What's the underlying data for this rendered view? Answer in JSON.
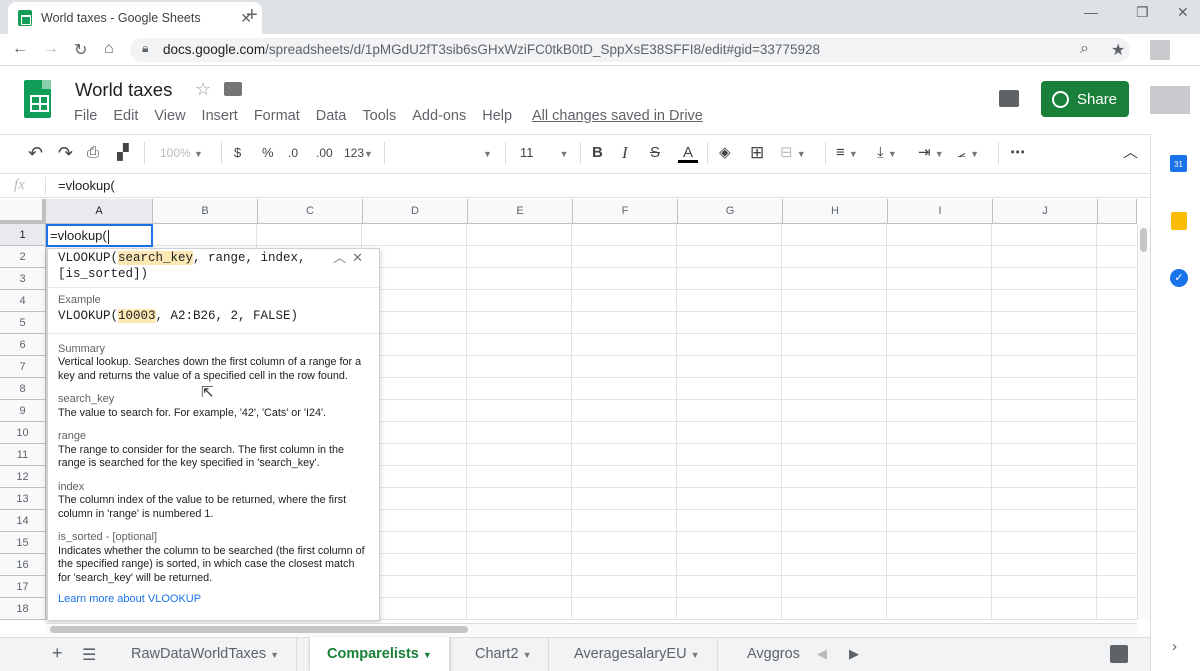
{
  "browser": {
    "tab_title": "World taxes - Google Sheets",
    "tab_close": "✕",
    "new_tab": "+",
    "url_host": "docs.google.com",
    "url_path": "/spreadsheets/d/1pMGdU2fT3sib6sGHxWziFC0tkB0tD_SppXsE38SFFI8/edit#gid=33775928"
  },
  "doc": {
    "title": "World taxes",
    "menu": [
      "File",
      "Edit",
      "View",
      "Insert",
      "Format",
      "Data",
      "Tools",
      "Add-ons",
      "Help"
    ],
    "saved_status": "All changes saved in Drive",
    "share_label": "Share"
  },
  "toolbar": {
    "zoom": "100%",
    "currency": "$",
    "percent": "%",
    "decrease_decimals": ".0",
    "increase_decimals": ".00",
    "more_formats": "123",
    "font_size": "11",
    "bold": "B",
    "italic": "I",
    "strikethrough": "S",
    "text_color": "A",
    "more": "⋯"
  },
  "formula_bar": {
    "fx": "fx",
    "value": "=vlookup("
  },
  "grid": {
    "columns": [
      "A",
      "B",
      "C",
      "D",
      "E",
      "F",
      "G",
      "H",
      "I",
      "J"
    ],
    "rows": [
      "1",
      "2",
      "3",
      "4",
      "5",
      "6",
      "7",
      "8",
      "9",
      "10",
      "11",
      "12",
      "13",
      "14",
      "15",
      "16",
      "17",
      "18"
    ],
    "active_cell_value": "=vlookup("
  },
  "help_popup": {
    "signature_prefix": "VLOOKUP(",
    "signature_key": "search_key",
    "signature_rest": ", range, index, [is_sorted])",
    "example_label": "Example",
    "example_prefix": "VLOOKUP(",
    "example_key": "10003",
    "example_rest": ", A2:B26, 2, FALSE)",
    "summary_label": "Summary",
    "summary_text": "Vertical lookup. Searches down the first column of a range for a key and returns the value of a specified cell in the row found.",
    "params": [
      {
        "name": "search_key",
        "desc": "The value to search for. For example, '42', 'Cats' or 'I24'."
      },
      {
        "name": "range",
        "desc": "The range to consider for the search. The first column in the range is searched for the key specified in 'search_key'."
      },
      {
        "name": "index",
        "desc": "The column index of the value to be returned, where the first column in 'range' is numbered 1."
      },
      {
        "name": "is_sorted - [optional]",
        "desc": "Indicates whether the column to be searched (the first column of the specified range) is sorted, in which case the closest match for 'search_key' will be returned."
      }
    ],
    "learn_more": "Learn more about VLOOKUP"
  },
  "sheet_tabs": {
    "add": "+",
    "tabs": [
      "RawDataWorldTaxes",
      "Comparelists",
      "Chart2",
      "AveragesalaryEU",
      "Avggros"
    ],
    "active_index": 1
  },
  "side_panel": {
    "calendar_badge": "31",
    "tasks_badge": "✓"
  },
  "colors": {
    "brand_green": "#0f9d58",
    "share_green": "#188038",
    "selection_blue": "#1a73e8",
    "highlight": "#fce8b2"
  },
  "icons": [
    "back-icon",
    "forward-icon",
    "reload-icon",
    "home-icon",
    "lock-icon",
    "zoom-icon",
    "bookmark-star-icon",
    "undo-icon",
    "redo-icon",
    "print-icon",
    "paint-format-icon",
    "fill-color-icon",
    "borders-icon",
    "merge-icon",
    "align-icon",
    "valign-icon",
    "wrap-icon",
    "rotate-icon",
    "collapse-icon",
    "comment-icon",
    "globe-icon",
    "calendar-icon",
    "keep-icon",
    "tasks-icon",
    "explore-icon",
    "all-sheets-icon"
  ]
}
